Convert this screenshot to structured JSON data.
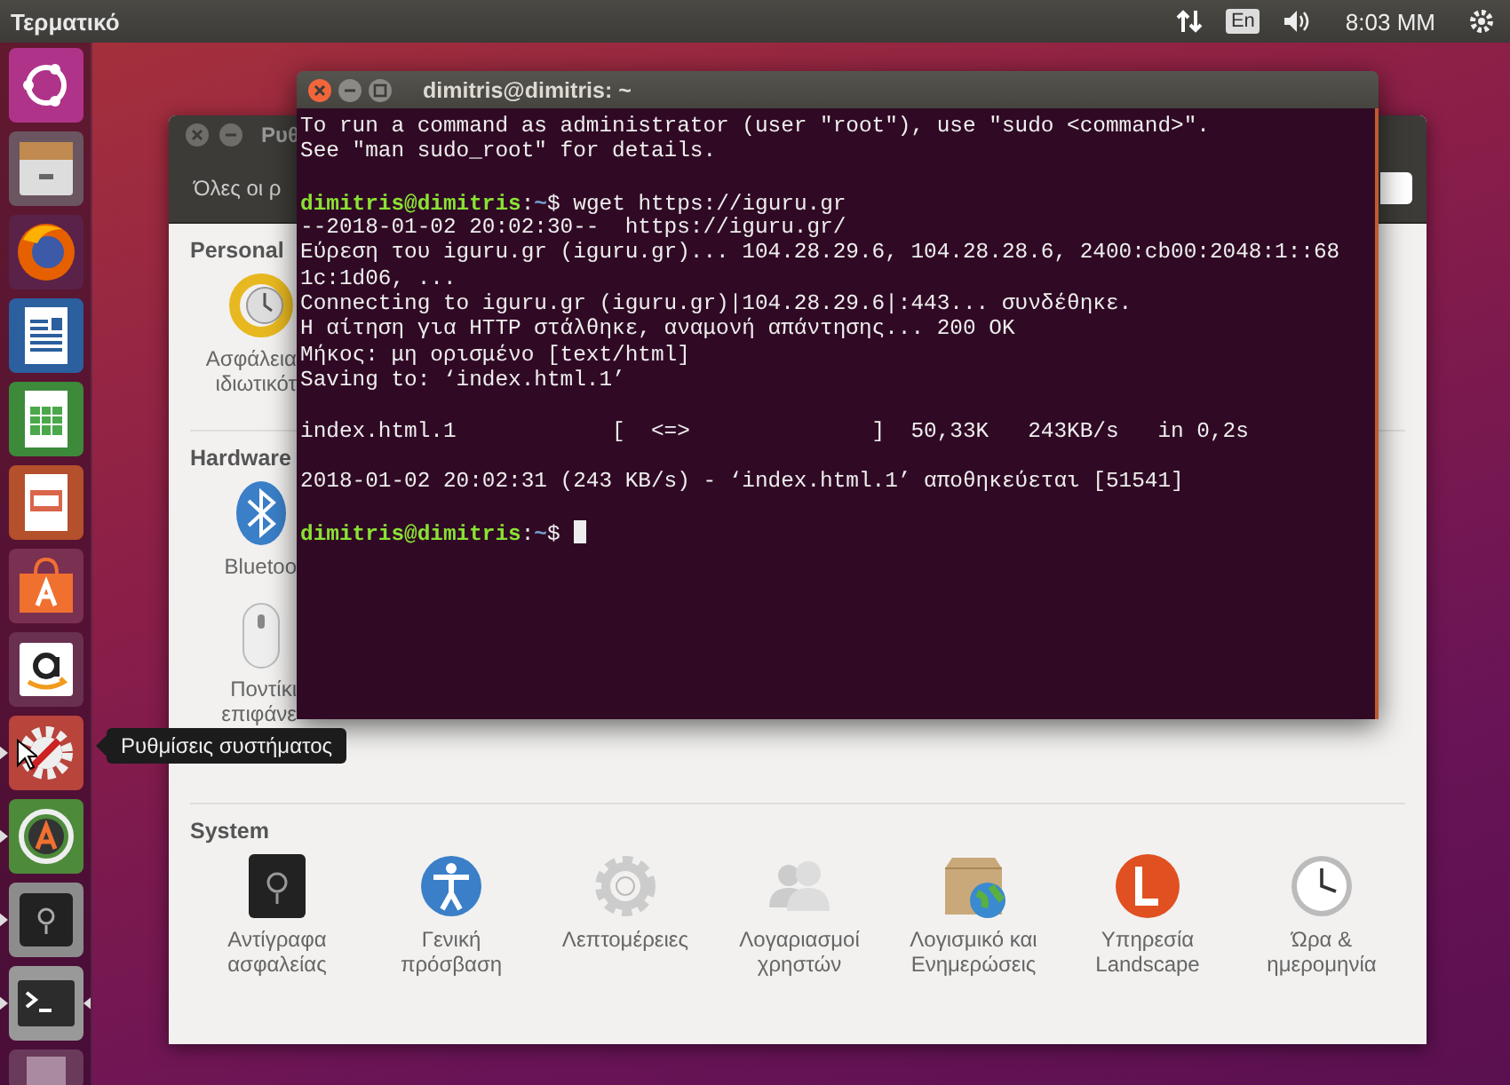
{
  "top_panel": {
    "app_title": "Τερματικό",
    "keyboard_layout": "En",
    "clock": "8:03 ΜΜ"
  },
  "launcher": {
    "items": [
      {
        "kind": "dash",
        "running": false,
        "focused": false
      },
      {
        "kind": "files",
        "running": false,
        "focused": false
      },
      {
        "kind": "firefox",
        "running": false,
        "focused": false
      },
      {
        "kind": "writer",
        "running": false,
        "focused": false
      },
      {
        "kind": "calc",
        "running": false,
        "focused": false
      },
      {
        "kind": "impress",
        "running": false,
        "focused": false
      },
      {
        "kind": "software",
        "running": false,
        "focused": false
      },
      {
        "kind": "amazon",
        "running": false,
        "focused": false
      },
      {
        "kind": "settings",
        "running": true,
        "focused": false
      },
      {
        "kind": "updater",
        "running": true,
        "focused": false
      },
      {
        "kind": "backup",
        "running": true,
        "focused": false
      },
      {
        "kind": "terminal",
        "running": true,
        "focused": true
      },
      {
        "kind": "trash",
        "running": false,
        "focused": false
      }
    ],
    "tooltip": "Ρυθμίσεις συστήματος"
  },
  "settings_window": {
    "title": "Ρυθ",
    "toolbar_button": "Όλες οι ρ",
    "sections": [
      {
        "title": "Personal",
        "items": [
          {
            "kind": "security",
            "lines": [
              "Ασφάλεια",
              "ιδιωτικότ"
            ]
          }
        ]
      },
      {
        "title": "Hardware",
        "items": [
          {
            "kind": "bluetooth",
            "lines": [
              "Bluetoo"
            ]
          },
          {
            "kind": "mouse",
            "lines": [
              "Ποντίκι",
              "επιφάνε"
            ]
          }
        ]
      },
      {
        "title": "System",
        "items": [
          {
            "kind": "backup",
            "lines": [
              "Αντίγραφα",
              "ασφαλείας"
            ]
          },
          {
            "kind": "accessibility",
            "lines": [
              "Γενική",
              "πρόσβαση"
            ]
          },
          {
            "kind": "details",
            "lines": [
              "Λεπτομέρειες"
            ]
          },
          {
            "kind": "users",
            "lines": [
              "Λογαριασμοί",
              "χρηστών"
            ]
          },
          {
            "kind": "software",
            "lines": [
              "Λογισμικό και",
              "Ενημερώσεις"
            ]
          },
          {
            "kind": "landscape",
            "lines": [
              "Υπηρεσία",
              "Landscape"
            ]
          },
          {
            "kind": "clock",
            "lines": [
              "Ώρα &",
              "ημερομηνία"
            ]
          }
        ]
      }
    ]
  },
  "terminal": {
    "title": "dimitris@dimitris: ~",
    "lines": [
      {
        "kind": "output",
        "text": "To run a command as administrator (user \"root\"), use \"sudo <command>\"."
      },
      {
        "kind": "output",
        "text": "See \"man sudo_root\" for details."
      },
      {
        "kind": "blank"
      },
      {
        "kind": "prompt",
        "user": "dimitris@dimitris",
        "separator": ":",
        "path": "~",
        "sign": "$",
        "command": "wget https://iguru.gr",
        "cursor": false
      },
      {
        "kind": "output",
        "text": "--2018-01-02 20:02:30--  https://iguru.gr/"
      },
      {
        "kind": "output",
        "text": "Εύρεση του iguru.gr (iguru.gr)... 104.28.29.6, 104.28.28.6, 2400:cb00:2048:1::68"
      },
      {
        "kind": "output",
        "text": "1c:1d06, ..."
      },
      {
        "kind": "output",
        "text": "Connecting to iguru.gr (iguru.gr)|104.28.29.6|:443... συνδέθηκε."
      },
      {
        "kind": "output",
        "text": "Η αίτηση για HTTP στάλθηκε, αναμονή απάντησης... 200 OK"
      },
      {
        "kind": "output",
        "text": "Μήκος: μη ορισμένο [text/html]"
      },
      {
        "kind": "output",
        "text": "Saving to: ‘index.html.1’"
      },
      {
        "kind": "blank"
      },
      {
        "kind": "output",
        "text": "index.html.1            [  <=>              ]  50,33K   243KB/s   in 0,2s"
      },
      {
        "kind": "blank"
      },
      {
        "kind": "output",
        "text": "2018-01-02 20:02:31 (243 KB/s) - ‘index.html.1’ αποθηκεύεται [51541]"
      },
      {
        "kind": "blank"
      },
      {
        "kind": "prompt",
        "user": "dimitris@dimitris",
        "separator": ":",
        "path": "~",
        "sign": "$",
        "cursor": true
      }
    ]
  }
}
